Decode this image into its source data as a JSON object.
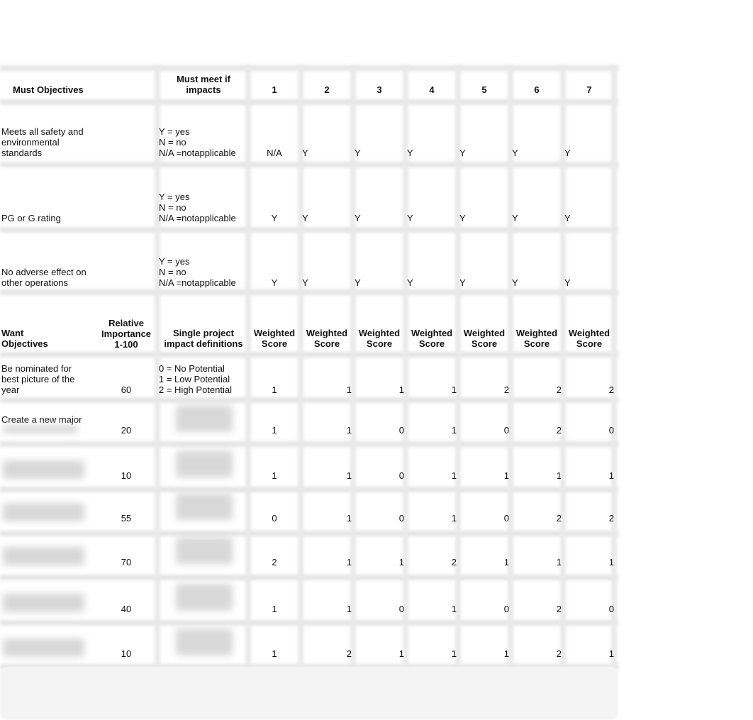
{
  "must_section": {
    "header": {
      "objectives_label": "Must Objectives",
      "must_meet_label": "Must meet if\nimpacts",
      "project_numbers": [
        "1",
        "2",
        "3",
        "4",
        "5",
        "6",
        "7"
      ]
    },
    "rows": [
      {
        "objective": "Meets all safety and\nenvironmental\nstandards",
        "definition": "Y = yes\nN = no\nN/A =notapplicable",
        "values": [
          "N/A",
          "Y",
          "Y",
          "Y",
          "Y",
          "Y",
          "Y"
        ]
      },
      {
        "objective": "PG or G rating",
        "definition": "Y = yes\nN = no\nN/A =notapplicable",
        "values": [
          "Y",
          "Y",
          "Y",
          "Y",
          "Y",
          "Y",
          "Y"
        ]
      },
      {
        "objective": "No adverse effect on\nother operations",
        "definition": "Y = yes\nN = no\nN/A =notapplicable",
        "values": [
          "Y",
          "Y",
          "Y",
          "Y",
          "Y",
          "Y",
          "Y"
        ]
      }
    ]
  },
  "want_section": {
    "header": {
      "objectives_label": "Want\nObjectives",
      "importance_label": "Relative\nImportance\n1-100",
      "definitions_label": "Single project\nimpact definitions",
      "score_labels": [
        "Weighted\nScore",
        "Weighted\nScore",
        "Weighted\nScore",
        "Weighted\nScore",
        "Weighted\nScore",
        "Weighted\nScore",
        "Weighted\nScore"
      ]
    },
    "rows": [
      {
        "objective": "Be nominated for\nbest picture of the\nyear",
        "importance": "60",
        "definition": "0 = No Potential\n1 = Low Potential\n2 = High Potential",
        "scores": [
          "1",
          "1",
          "1",
          "1",
          "2",
          "2",
          "2"
        ]
      },
      {
        "objective": "Create a new major",
        "importance": "20",
        "definition": "",
        "scores": [
          "1",
          "1",
          "0",
          "1",
          "0",
          "2",
          "0"
        ]
      },
      {
        "objective": "",
        "importance": "10",
        "definition": "",
        "scores": [
          "1",
          "1",
          "0",
          "1",
          "1",
          "1",
          "1"
        ]
      },
      {
        "objective": "",
        "importance": "55",
        "definition": "",
        "scores": [
          "0",
          "1",
          "0",
          "1",
          "0",
          "2",
          "2"
        ]
      },
      {
        "objective": "",
        "importance": "70",
        "definition": "",
        "scores": [
          "2",
          "1",
          "1",
          "2",
          "1",
          "1",
          "1"
        ]
      },
      {
        "objective": "",
        "importance": "40",
        "definition": "",
        "scores": [
          "1",
          "1",
          "0",
          "1",
          "0",
          "2",
          "0"
        ]
      },
      {
        "objective": "",
        "importance": "10",
        "definition": "",
        "scores": [
          "1",
          "2",
          "1",
          "1",
          "1",
          "2",
          "1"
        ]
      }
    ]
  }
}
